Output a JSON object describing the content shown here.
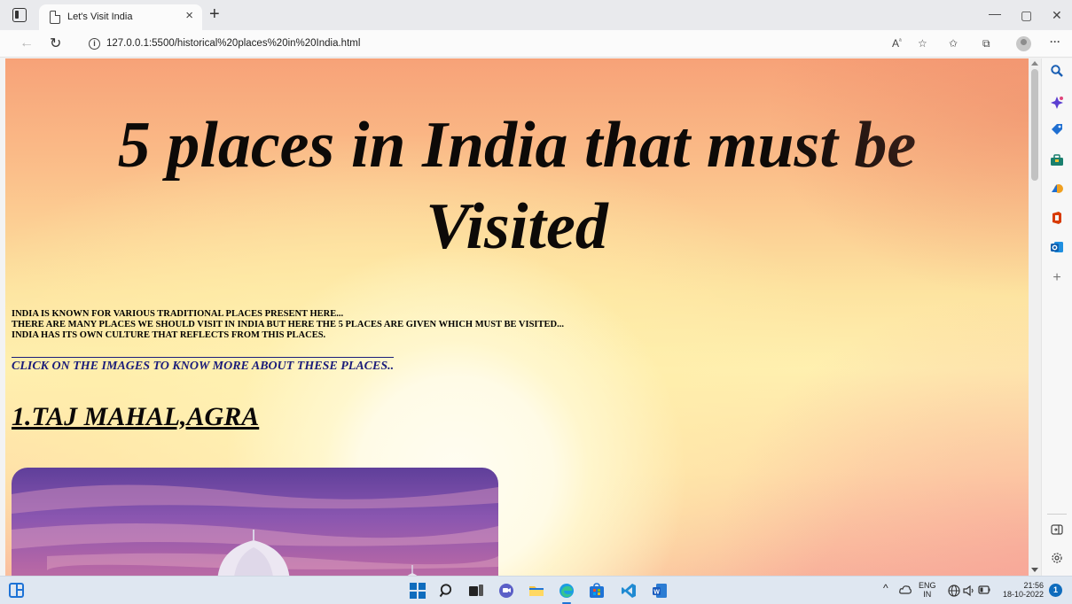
{
  "browser": {
    "tab_title": "Let's Visit India",
    "tab_close": "×",
    "new_tab": "+",
    "url": "127.0.0.1:5500/historical%20places%20in%20India.html",
    "window_minimize": "—",
    "window_restore": "▢",
    "window_close": "✕",
    "more_menu": "···"
  },
  "page": {
    "heading_line1": "5 places in India that must be",
    "heading_line2": "Visited",
    "intro_lines": [
      "INDIA IS KNOWN FOR VARIOUS TRADITIONAL PLACES PRESENT HERE...",
      "THERE ARE MANY PLACES WE SHOULD VISIT IN INDIA BUT HERE THE 5 PLACES ARE GIVEN WHICH MUST BE VISITED...",
      "INDIA HAS ITS OWN CULTURE THAT REFLECTS FROM THIS PLACES."
    ],
    "images_link": "CLICK ON THE IMAGES TO KNOW MORE ABOUT THESE PLACES..",
    "places": [
      {
        "heading": "1.TAJ MAHAL,AGRA"
      }
    ]
  },
  "sidebar": {
    "icons": [
      "search-icon",
      "copilot-icon",
      "shopping-tag-icon",
      "tools-icon",
      "games-icon",
      "office-icon",
      "outlook-icon",
      "add-icon",
      "hide-sidebar-icon",
      "settings-icon"
    ]
  },
  "taskbar": {
    "lang_top": "ENG",
    "lang_bottom": "IN",
    "time": "21:56",
    "date": "18-10-2022",
    "notification_count": "1"
  },
  "colors": {
    "link": "#1b1d7a",
    "heading": "#0d0a08",
    "edge_blue": "#0f6cbd"
  }
}
